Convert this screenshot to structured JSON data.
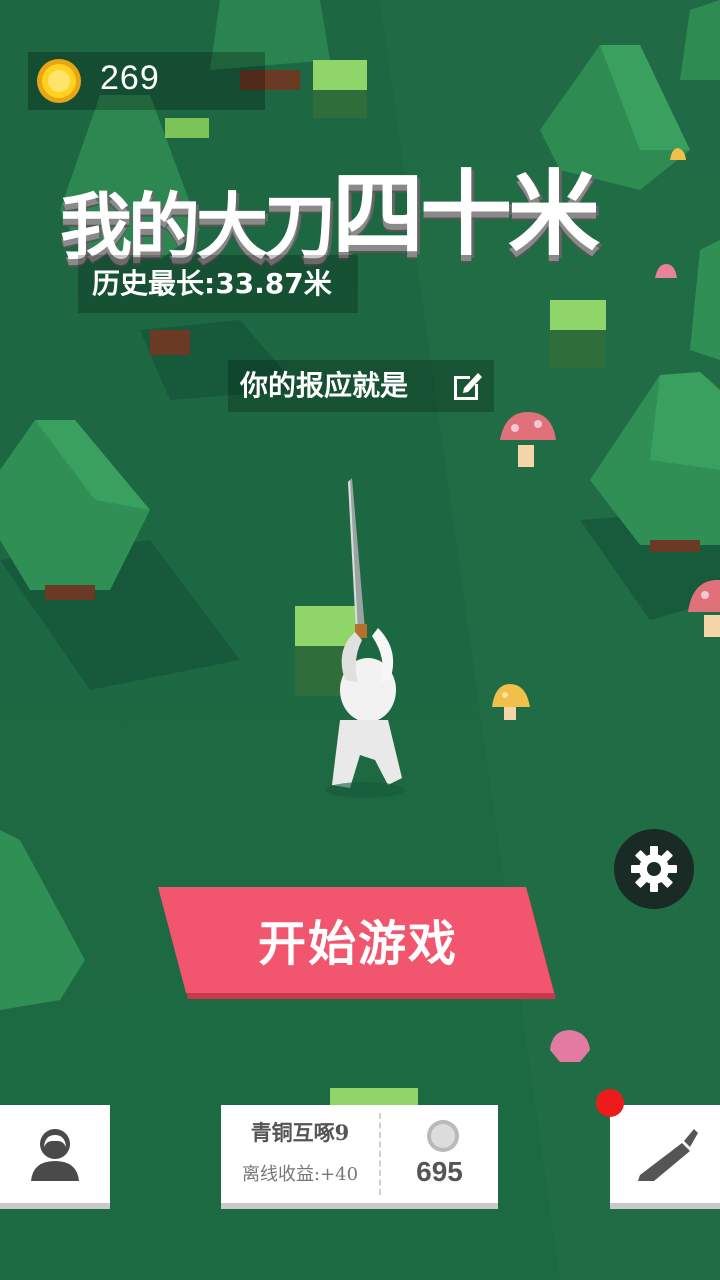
{
  "hud": {
    "coin_icon": "gold-coin-icon",
    "coin_count": "269"
  },
  "title": {
    "part1": "我的大刀",
    "part2": "四十米"
  },
  "record": {
    "label": "历史最长:33.87米"
  },
  "slogan": {
    "text": "你的报应就是",
    "edit_icon": "edit-icon"
  },
  "settings": {
    "icon": "gear-icon"
  },
  "start": {
    "label": "开始游戏",
    "color": "#f2566f"
  },
  "bottom_bar": {
    "profile_icon": "profile-icon",
    "rank_title": "青铜互啄9",
    "offline_income": "离线收益:+40",
    "silver_icon": "silver-coin-icon",
    "silver_count": "695",
    "knife_icon": "knife-icon",
    "notification_color": "#ee1b1b"
  },
  "colors": {
    "ground": "#1f6a44",
    "tree": "#2f8f55",
    "mushroom_red": "#e0707a",
    "mushroom_yellow": "#f0c04a"
  }
}
